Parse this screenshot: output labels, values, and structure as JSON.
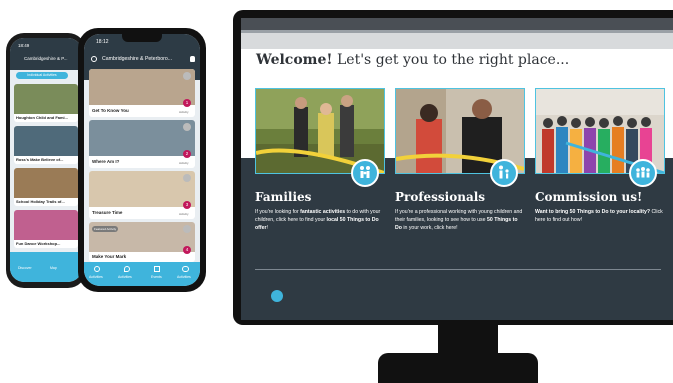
{
  "website": {
    "welcome_bold": "Welcome!",
    "welcome_rest": " Let's get you to the right place...",
    "cards": [
      {
        "title": "Families",
        "text_1": "If you're looking for ",
        "bold_1": "fantastic activities",
        "text_2": " to do with your children, click here to find your ",
        "bold_2": "local 50 Things to Do offer",
        "text_3": "!",
        "icon": "family-icon"
      },
      {
        "title": "Professionals",
        "text_1": "If you're a professional working with young children and their families, looking to see how to use ",
        "bold_1": "50 Things to Do",
        "text_2": " in your work, click here!",
        "icon": "adult-child-icon"
      },
      {
        "title": "Commission us!",
        "bold_1": "Want to bring 50 Things to Do to your locality?",
        "text_1": " Click here to find out how!",
        "icon": "group-icon"
      }
    ]
  },
  "phone_front": {
    "time": "18:12",
    "location": "Cambridgeshire & Peterboro...",
    "items": [
      {
        "label": "Get To Know You",
        "badge": "1",
        "sub": "Activity"
      },
      {
        "label": "Where Am I?",
        "badge": "2",
        "sub": "Activity"
      },
      {
        "label": "Treasure Time",
        "badge": "3",
        "sub": "Activity"
      },
      {
        "label": "Make Your Mark",
        "badge": "4",
        "sub": "Activity",
        "tag": "Featured Activity"
      }
    ],
    "tabs": [
      "Activities",
      "Activities",
      "Events",
      "Activities"
    ]
  },
  "phone_back": {
    "time": "18:49",
    "location": "Cambridgeshire & P...",
    "pill": "Individual Activities",
    "items": [
      {
        "label": "Houghton Child and Fami..."
      },
      {
        "label": "Ross's Make Believe of..."
      },
      {
        "label": "School Holiday Trails of..."
      },
      {
        "label": "Fun Dance Workshop..."
      }
    ],
    "tabs": [
      "Discover",
      "Map"
    ]
  },
  "colors": {
    "accent": "#3fb4dc",
    "dark_panel": "#2f3a43",
    "badge": "#c2185b"
  }
}
